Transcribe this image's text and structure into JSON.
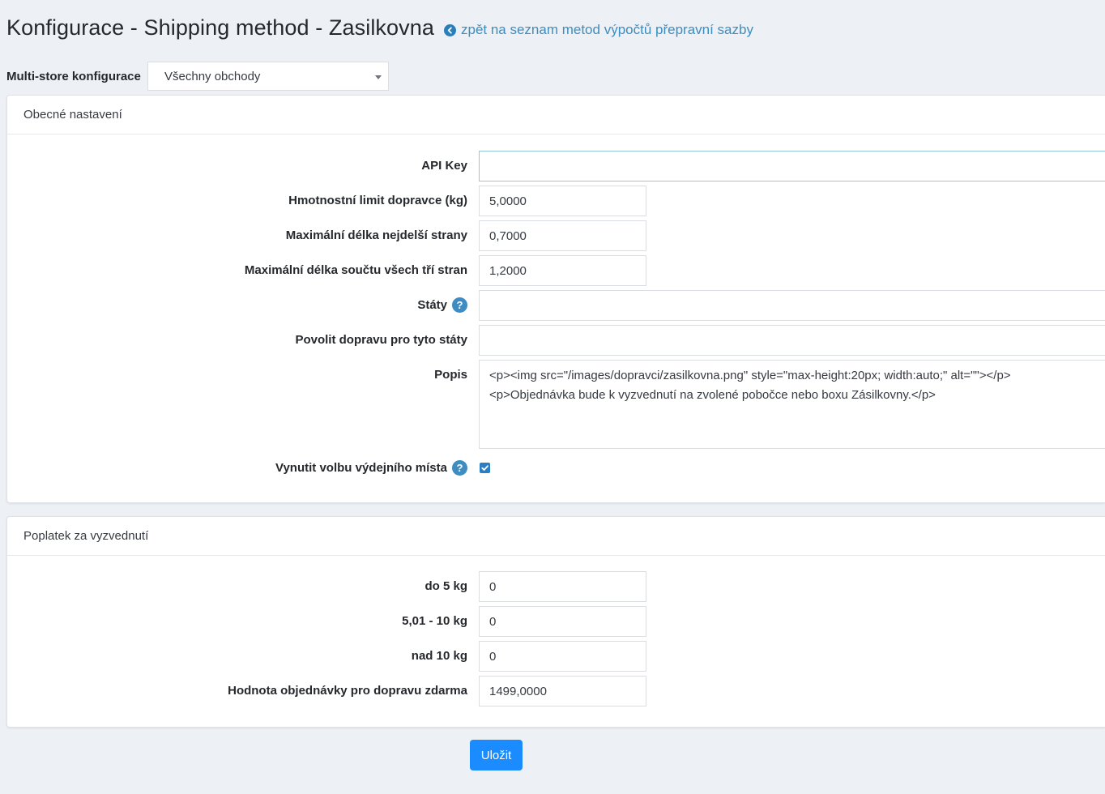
{
  "header": {
    "title": "Konfigurace - Shipping method - Zasilkovna",
    "back_link": "zpět na seznam metod výpočtů přepravní sazby"
  },
  "multistore": {
    "label": "Multi-store konfigurace",
    "selected": "Všechny obchody"
  },
  "general": {
    "heading": "Obecné nastavení",
    "fields": {
      "api_key": {
        "label": "API Key",
        "value": ""
      },
      "weight_limit": {
        "label": "Hmotnostní limit dopravce (kg)",
        "value": "5,0000"
      },
      "max_longest_side": {
        "label": "Maximální délka nejdelší strany",
        "value": "0,7000"
      },
      "max_sum_sides": {
        "label": "Maximální délka součtu všech tří stran",
        "value": "1,2000"
      },
      "states": {
        "label": "Státy",
        "value": ""
      },
      "allowed_states": {
        "label": "Povolit dopravu pro tyto státy",
        "value": ""
      },
      "description": {
        "label": "Popis",
        "value": "<p><img src=\"/images/dopravci/zasilkovna.png\" style=\"max-height:20px; width:auto;\" alt=\"\"></p>\n<p>Objednávka bude k vyzvednutí na zvolené pobočce nebo boxu Zásilkovny.</p>"
      },
      "force_pickup": {
        "label": "Vynutit volbu výdejního místa",
        "checked": true
      }
    }
  },
  "fees": {
    "heading": "Poplatek za vyzvednutí",
    "fields": {
      "up_to_5": {
        "label": "do 5 kg",
        "value": "0"
      },
      "from_5_to_10": {
        "label": "5,01 - 10 kg",
        "value": "0"
      },
      "over_10": {
        "label": "nad 10 kg",
        "value": "0"
      },
      "free_shipping_value": {
        "label": "Hodnota objednávky pro dopravu zdarma",
        "value": "1499,0000"
      }
    }
  },
  "actions": {
    "save": "Uložit"
  },
  "colors": {
    "accent": "#1a8cff",
    "link": "#3b8ec1",
    "help_icon": "#3d8cc2"
  }
}
